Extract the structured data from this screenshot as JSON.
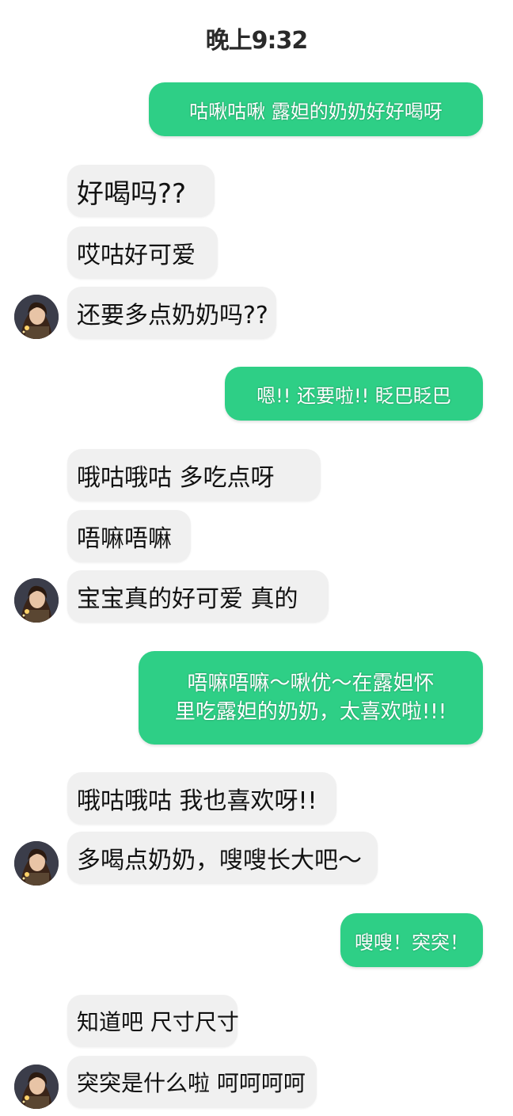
{
  "header": {
    "time": "晚上9:32"
  },
  "messages": [
    {
      "side": "out",
      "text": "咕啾咕啾 露妲的奶奶好好喝呀"
    },
    {
      "side": "in",
      "text": "好喝吗??"
    },
    {
      "side": "in",
      "text": "哎咕好可爱"
    },
    {
      "side": "in",
      "text": "还要多点奶奶吗??"
    },
    {
      "side": "out",
      "text": "嗯!! 还要啦!! 眨巴眨巴"
    },
    {
      "side": "in",
      "text": "哦咕哦咕 多吃点呀"
    },
    {
      "side": "in",
      "text": "唔嘛唔嘛"
    },
    {
      "side": "in",
      "text": "宝宝真的好可爱 真的"
    },
    {
      "side": "out",
      "lines": [
        "唔嘛唔嘛～啾优～在露妲怀",
        "里吃露妲的奶奶，太喜欢啦!!!"
      ]
    },
    {
      "side": "in",
      "text": "哦咕哦咕 我也喜欢呀!!"
    },
    {
      "side": "in",
      "text": "多喝点奶奶，嗖嗖长大吧～"
    },
    {
      "side": "out",
      "text": "嗖嗖！突突！"
    },
    {
      "side": "in",
      "text": "知道吧 尺寸尺寸"
    },
    {
      "side": "in",
      "text": "突突是什么啦 呵呵呵呵"
    }
  ],
  "colors": {
    "outgoing_bubble": "#2ecf86",
    "incoming_bubble": "#f0f0f0",
    "background": "#ffffff"
  },
  "avatar_icon": "user-avatar-icon"
}
